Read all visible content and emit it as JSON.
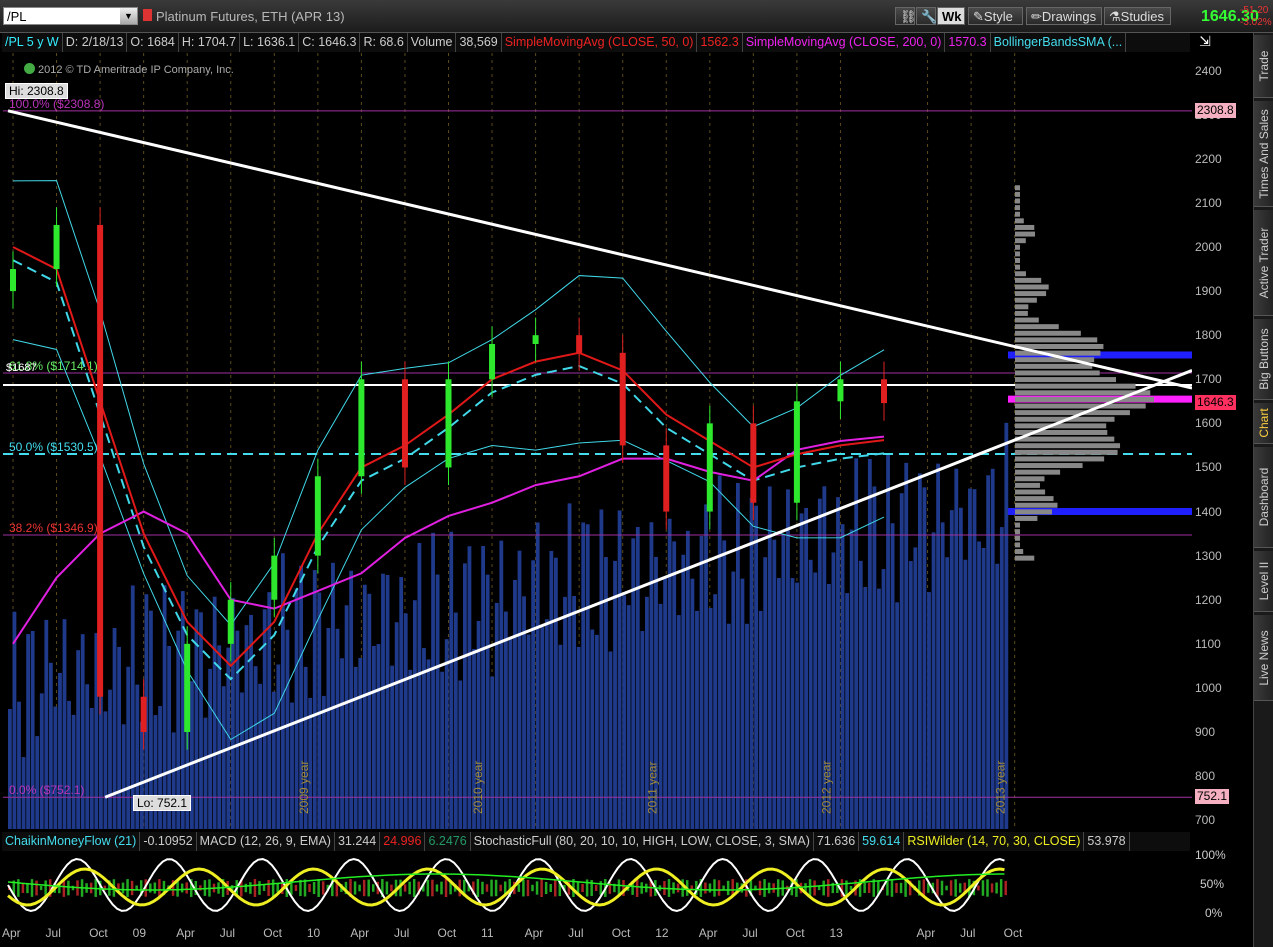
{
  "toolbar": {
    "symbol": "/PL",
    "description": "Platinum Futures, ETH (APR 13)",
    "interval": "Wk",
    "style_label": "Style",
    "drawings_label": "Drawings",
    "studies_label": "Studies",
    "last_price": "1646.30",
    "change": "-51.20",
    "change_pct": "-3.02%"
  },
  "header": {
    "symbol_period": "/PL 5 y W",
    "date": "D: 2/18/13",
    "open": "O: 1684",
    "high": "H: 1704.7",
    "low": "L: 1636.1",
    "close": "C: 1646.3",
    "range": "R: 68.6",
    "volume_label": "Volume",
    "volume_value": "38,569",
    "sma50_label": "SimpleMovingAvg (CLOSE, 50, 0)",
    "sma50_value": "1562.3",
    "sma200_label": "SimpleMovingAvg (CLOSE, 200, 0)",
    "sma200_value": "1570.3",
    "bb_label": "BollingerBandsSMA (..."
  },
  "copyright": "2012 © TD Ameritrade IP Company, Inc.",
  "hi_label": "Hi: 2308.8",
  "lo_label": "Lo: 752.1",
  "price_line_label": "$1687",
  "colors": {
    "up": "#2ee82e",
    "down": "#e02020",
    "sma50": "#e01818",
    "sma200": "#e020e0",
    "bb": "#40d8e8",
    "volume": "#1f3a8a",
    "trend": "#ffffff",
    "fib": "#b020b0"
  },
  "chart_data": {
    "type": "candlestick",
    "title": "Platinum Futures, ETH (APR 13)",
    "x": [
      "2008 Apr",
      "2008 Jul",
      "2008 Oct",
      "2009 Jan",
      "2009 Apr",
      "2009 Jul",
      "2009 Oct",
      "2010 Jan",
      "2010 Apr",
      "2010 Jul",
      "2010 Oct",
      "2011 Jan",
      "2011 Apr",
      "2011 Jul",
      "2011 Oct",
      "2012 Jan",
      "2012 Apr",
      "2012 Jul",
      "2012 Oct",
      "2013 Jan",
      "2013 Feb"
    ],
    "close": [
      1950,
      2050,
      980,
      900,
      1100,
      1200,
      1300,
      1480,
      1700,
      1500,
      1700,
      1780,
      1800,
      1760,
      1550,
      1400,
      1600,
      1420,
      1650,
      1700,
      1646
    ],
    "sma50": [
      2000,
      1950,
      1650,
      1350,
      1150,
      1050,
      1150,
      1350,
      1500,
      1550,
      1620,
      1700,
      1740,
      1760,
      1720,
      1620,
      1560,
      1500,
      1530,
      1550,
      1562
    ],
    "sma200": [
      1100,
      1250,
      1350,
      1400,
      1350,
      1200,
      1180,
      1220,
      1260,
      1340,
      1390,
      1420,
      1460,
      1480,
      1520,
      1520,
      1490,
      1470,
      1540,
      1560,
      1570
    ],
    "ylim": [
      680,
      2440
    ],
    "y_ticks": [
      2400,
      2300,
      2200,
      2100,
      2000,
      1900,
      1800,
      1700,
      1600,
      1500,
      1400,
      1300,
      1200,
      1100,
      1000,
      900,
      800,
      700
    ],
    "x_ticks": [
      {
        "label": "Apr",
        "i": 0
      },
      {
        "label": "Jul",
        "i": 1
      },
      {
        "label": "Oct",
        "i": 2
      },
      {
        "label": "09",
        "i": 3
      },
      {
        "label": "Apr",
        "i": 4
      },
      {
        "label": "Jul",
        "i": 5
      },
      {
        "label": "Oct",
        "i": 6
      },
      {
        "label": "10",
        "i": 7
      },
      {
        "label": "Apr",
        "i": 8
      },
      {
        "label": "Jul",
        "i": 9
      },
      {
        "label": "Oct",
        "i": 10
      },
      {
        "label": "11",
        "i": 11
      },
      {
        "label": "Apr",
        "i": 12
      },
      {
        "label": "Jul",
        "i": 13
      },
      {
        "label": "Oct",
        "i": 14
      },
      {
        "label": "12",
        "i": 15
      },
      {
        "label": "Apr",
        "i": 16
      },
      {
        "label": "Jul",
        "i": 17
      },
      {
        "label": "Oct",
        "i": 18
      },
      {
        "label": "13",
        "i": 19
      },
      {
        "label": "Apr",
        "i": 21
      },
      {
        "label": "Jul",
        "i": 22
      },
      {
        "label": "Oct",
        "i": 23
      }
    ],
    "year_markers": [
      "2009 year",
      "2010 year",
      "2011 year",
      "2012 year",
      "2013 year"
    ],
    "fib_levels": [
      {
        "label": "100.0% ($2308.8)",
        "value": 2308.8
      },
      {
        "label": "61.8% ($1714.1)",
        "value": 1714.1
      },
      {
        "label": "50.0% ($1530.5)",
        "value": 1530.5
      },
      {
        "label": "38.2% ($1346.9)",
        "value": 1346.9
      },
      {
        "label": "0.0% ($752.1)",
        "value": 752.1
      }
    ],
    "price_labels": [
      {
        "text": "2308.8",
        "value": 2308.8,
        "color": "#f4b0c0"
      },
      {
        "text": "1646.3",
        "value": 1646.3,
        "color": "#ff3060"
      },
      {
        "text": "752.1",
        "value": 752.1,
        "color": "#f4b0c0"
      }
    ],
    "horizontal_line": 1687,
    "zones": [
      {
        "value": 1755,
        "color": "#2020ff"
      },
      {
        "value": 1655,
        "color": "#ff20ff"
      },
      {
        "value": 1400,
        "color": "#2020ff"
      }
    ]
  },
  "lower": {
    "cmf_label": "ChaikinMoneyFlow (21)",
    "cmf_value": "-0.10952",
    "macd_label": "MACD (12, 26, 9, EMA)",
    "macd_v1": "31.244",
    "macd_v2": "24.996",
    "macd_v3": "6.2476",
    "stoch_label": "StochasticFull (80, 20, 10, 10, HIGH, LOW, CLOSE, 3, SMA)",
    "stoch_v1": "71.636",
    "stoch_v2": "59.614",
    "rsi_label": "RSIWilder (14, 70, 30, CLOSE)",
    "rsi_value": "53.978",
    "ticks": [
      "100%",
      "50%",
      "0%"
    ]
  },
  "side_tabs": [
    "Trade",
    "Times And Sales",
    "Active Trader",
    "Big Buttons",
    "Chart",
    "Dashboard",
    "Level II",
    "Live News"
  ]
}
